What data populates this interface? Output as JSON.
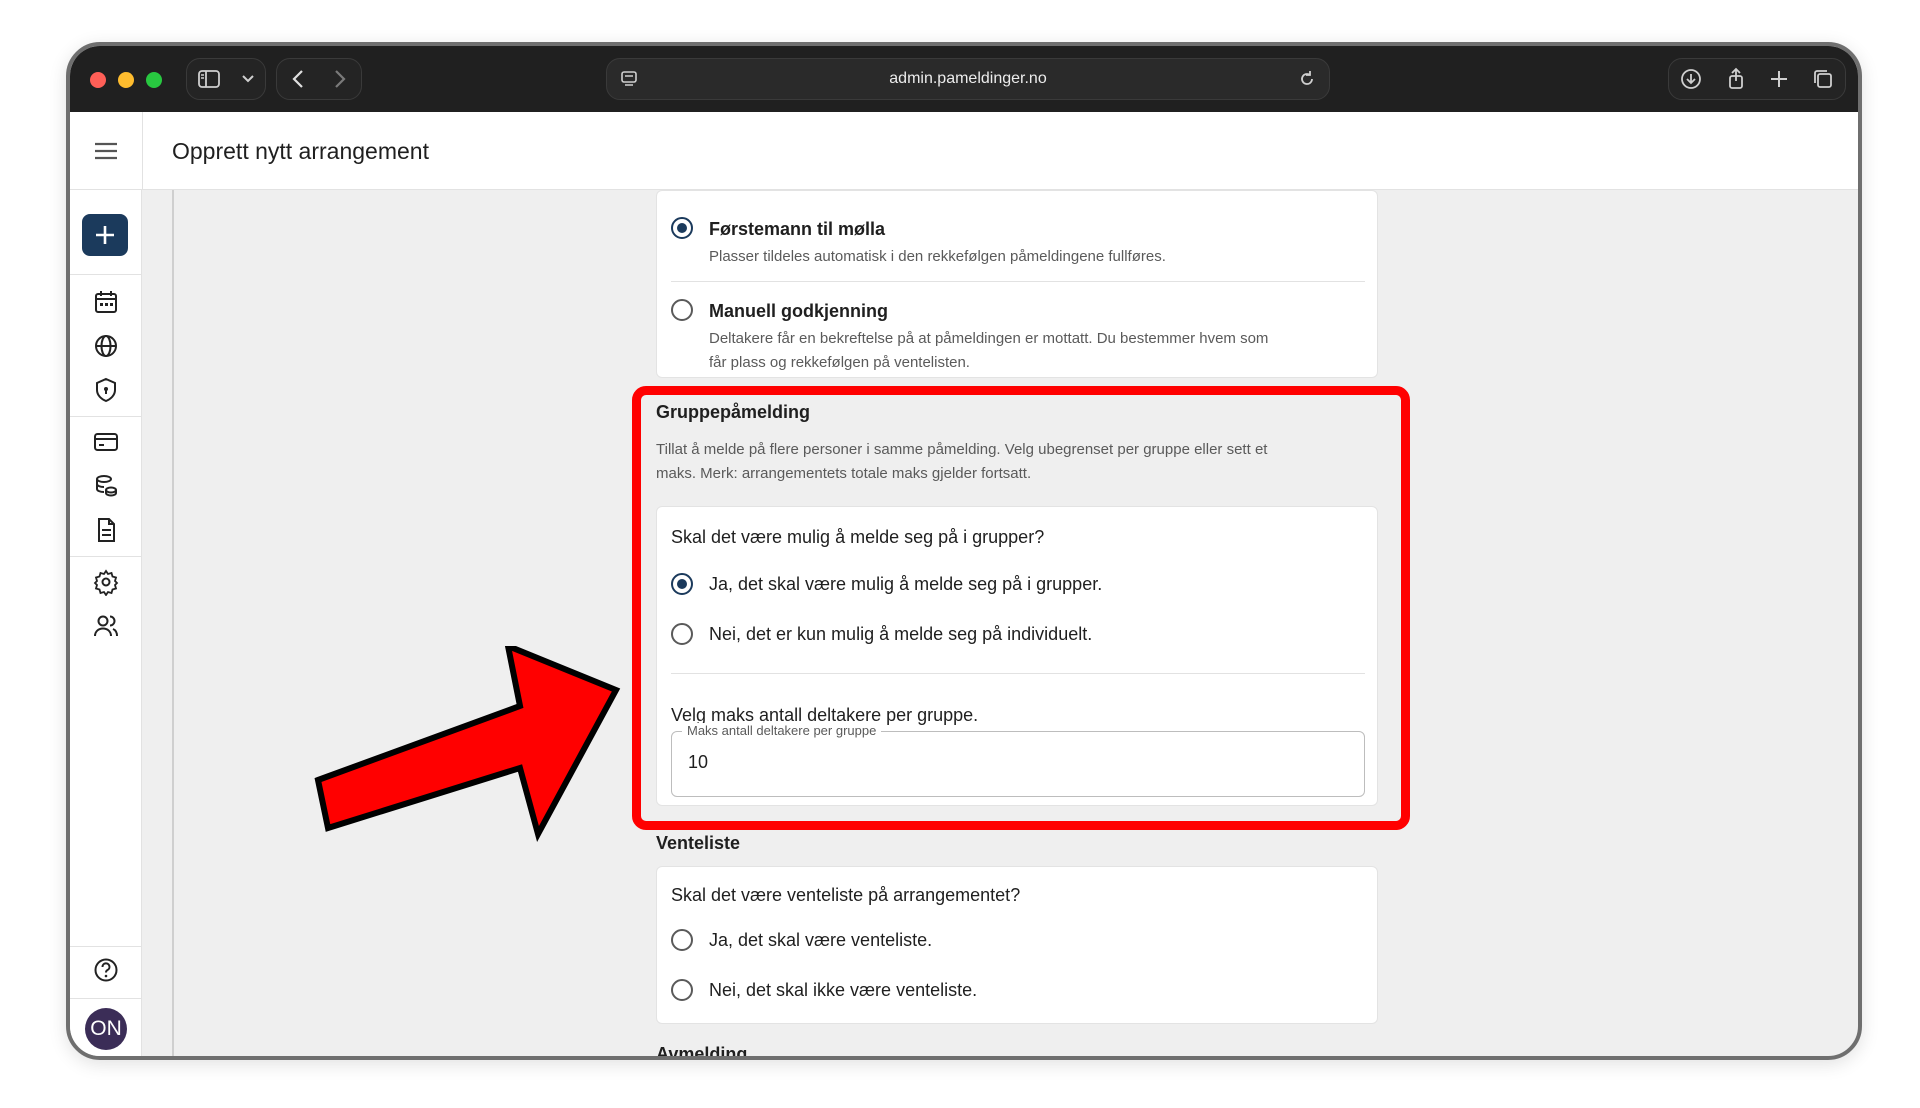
{
  "browser": {
    "url": "admin.pameldinger.no"
  },
  "header": {
    "title": "Opprett nytt arrangement"
  },
  "avatar": {
    "initials": "ON"
  },
  "tildeling": {
    "options": [
      {
        "title": "Førstemann til mølla",
        "desc": "Plasser tildeles automatisk i den rekkefølgen påmeldingene fullføres.",
        "selected": true
      },
      {
        "title": "Manuell godkjenning",
        "desc_line1": "Deltakere får en bekreftelse på at påmeldingen er mottatt. Du bestemmer hvem som",
        "desc_line2": "får plass og rekkefølgen på ventelisten.",
        "selected": false
      }
    ]
  },
  "gruppe": {
    "title": "Gruppepåmelding",
    "desc_line1": "Tillat å melde på flere personer i samme påmelding. Velg ubegrenset per gruppe eller sett et",
    "desc_line2": "maks. Merk: arrangementets totale maks gjelder fortsatt.",
    "question": "Skal det være mulig å melde seg på i grupper?",
    "options": [
      {
        "label": "Ja, det skal være mulig å melde seg på i grupper.",
        "selected": true
      },
      {
        "label": "Nei, det er kun mulig å melde seg på individuelt.",
        "selected": false
      }
    ],
    "max_question": "Velg maks antall deltakere per gruppe.",
    "max_field": {
      "legend": "Maks antall deltakere per gruppe",
      "value": "10"
    }
  },
  "venteliste": {
    "title": "Venteliste",
    "question": "Skal det være venteliste på arrangementet?",
    "options": [
      {
        "label": "Ja, det skal være venteliste.",
        "selected": false
      },
      {
        "label": "Nei, det skal ikke være venteliste.",
        "selected": false
      }
    ]
  },
  "next_section": {
    "title": "Avmelding"
  },
  "annotation": {
    "highlight_color": "#ff0000",
    "arrow_color": "#ff0000"
  },
  "icons": [
    "menu-icon",
    "plus-icon",
    "calendar-icon",
    "globe-icon",
    "shield-icon",
    "credit-card-icon",
    "database-icon",
    "document-icon",
    "gear-icon",
    "users-icon",
    "help-icon"
  ]
}
